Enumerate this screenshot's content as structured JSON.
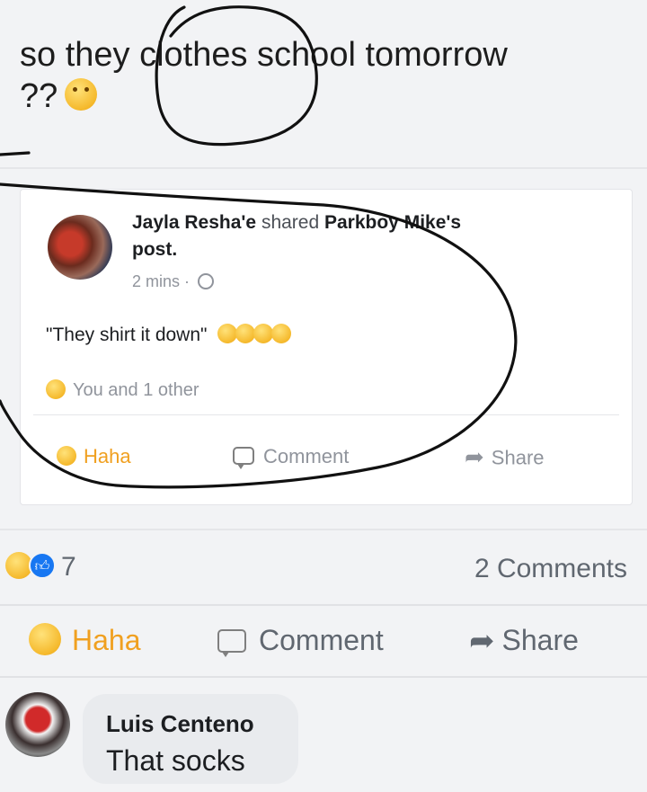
{
  "post": {
    "text_part1": "so they",
    "text_part2": "clothes school tomorrow",
    "text_part3": "??",
    "emoji": "thinking-face-icon"
  },
  "shared_card": {
    "author": "Jayla Resha'e",
    "verb": "shared",
    "original_author": "Parkboy Mike's",
    "post_word": "post.",
    "time": "2 mins",
    "separator": "·",
    "privacy_icon": "globe-icon",
    "quote": "\"They shirt it down\"",
    "quote_emoji": "laughing-face-icon",
    "reactions_text": "You and 1 other",
    "actions": {
      "haha": "Haha",
      "comment": "Comment",
      "share": "Share"
    }
  },
  "summary": {
    "reaction_count": "7",
    "comments_count": "2 Comments"
  },
  "actions": {
    "haha": "Haha",
    "comment": "Comment",
    "share": "Share"
  },
  "comment": {
    "author": "Luis Centeno",
    "text": "That socks"
  },
  "colors": {
    "haha": "#f0a020",
    "like": "#1877f2",
    "muted": "#606770",
    "scribble": "#111111"
  }
}
